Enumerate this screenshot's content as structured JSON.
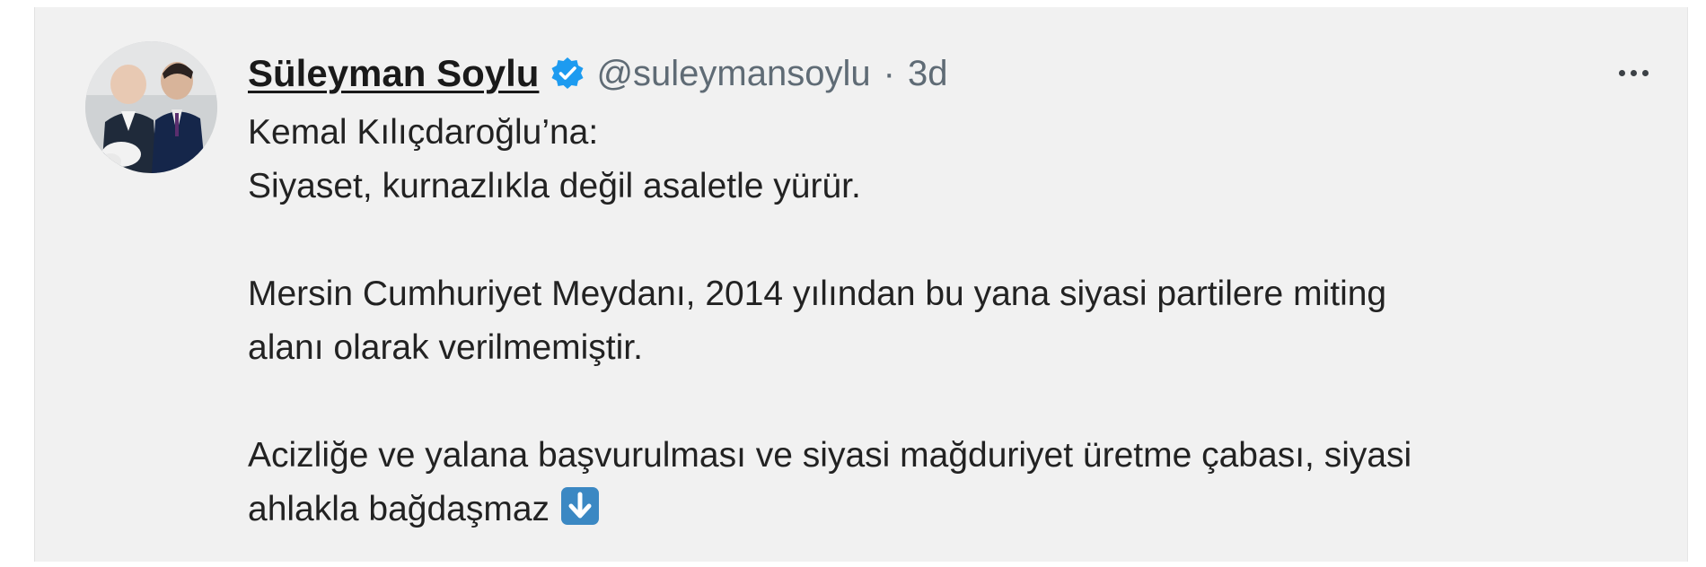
{
  "tweet": {
    "author": {
      "display_name": "Süleyman Soylu",
      "handle": "@suleymansoylu",
      "verified": true,
      "verified_color": "#1d9bf0"
    },
    "separator": "·",
    "timestamp": "3d",
    "more_icon": "more-horizontal-icon",
    "body": {
      "line1": "Kemal Kılıçdaroğlu’na:",
      "line2": "Siyaset, kurnazlıkla değil asaletle yürür.",
      "paragraph2_line1": "Mersin Cumhuriyet Meydanı, 2014 yılından bu yana siyasi partilere miting",
      "paragraph2_line2": "alanı olarak verilmemiştir.",
      "paragraph3_line1": "Acizliğe ve yalana başvurulması ve siyasi mağduriyet üretme çabası, siyasi",
      "paragraph3_line2": "ahlakla bağdaşmaz",
      "emoji": "down-arrow-emoji"
    },
    "colors": {
      "card_background": "#f1f1f1",
      "text": "#222222",
      "muted": "#5f6b75",
      "emoji_blue": "#3b88c3"
    }
  }
}
